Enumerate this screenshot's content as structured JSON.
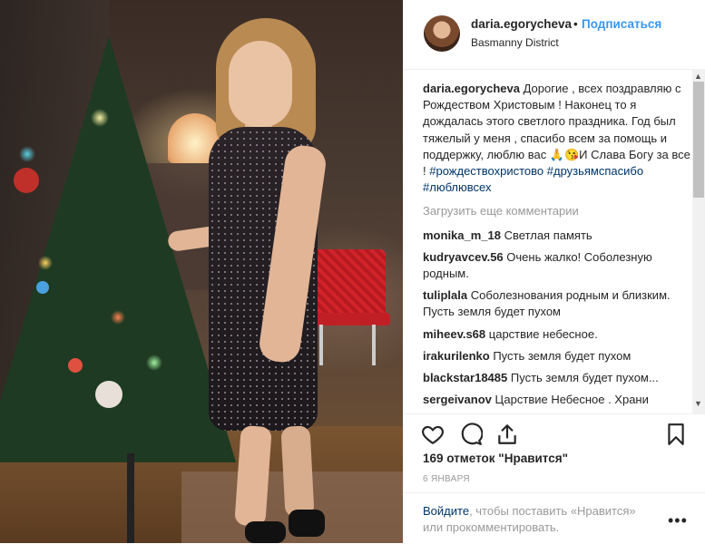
{
  "post": {
    "username": "daria.egorycheva",
    "follow_label": "Подписаться",
    "separator": "•",
    "location": "Basmanny District"
  },
  "caption": {
    "username": "daria.egorycheva",
    "text": "Дорогие , всех поздравляю с Рождеством Христовым ! Наконец то я дождалась этого светлого праздника. Год был тяжелый у меня , спасибо всем за помощь и поддержку, люблю вас 🙏😘И Слава Богу за все !",
    "hashtags": [
      "#рождествохристово",
      "#друзьямспасибо",
      "#люблювсех"
    ]
  },
  "load_more_label": "Загрузить еще комментарии",
  "comments": [
    {
      "user": "monika_m_18",
      "text": "Светлая память"
    },
    {
      "user": "kudryavcev.56",
      "text": "Очень жалко! Соболезную родным."
    },
    {
      "user": "tuliplala",
      "text": "Соболезнования родным и близким. Пусть земля будет пухом"
    },
    {
      "user": "miheev.s68",
      "text": "царствие небесное."
    },
    {
      "user": "irakurilenko",
      "text": "Пусть земля будет пухом"
    },
    {
      "user": "blackstar18485",
      "text": "Пусть земля будет пухом..."
    },
    {
      "user": "sergeivanov",
      "text": "Царствие Небесное . Храни"
    }
  ],
  "likes_label": "169 отметок \"Нравится\"",
  "date_label": "6 ЯНВАРЯ",
  "login": {
    "link": "Войдите",
    "rest": ", чтобы поставить «Нравится» или прокомментировать."
  },
  "more_label": "•••",
  "icons": [
    "heart-icon",
    "comment-icon",
    "share-icon",
    "bookmark-icon"
  ]
}
